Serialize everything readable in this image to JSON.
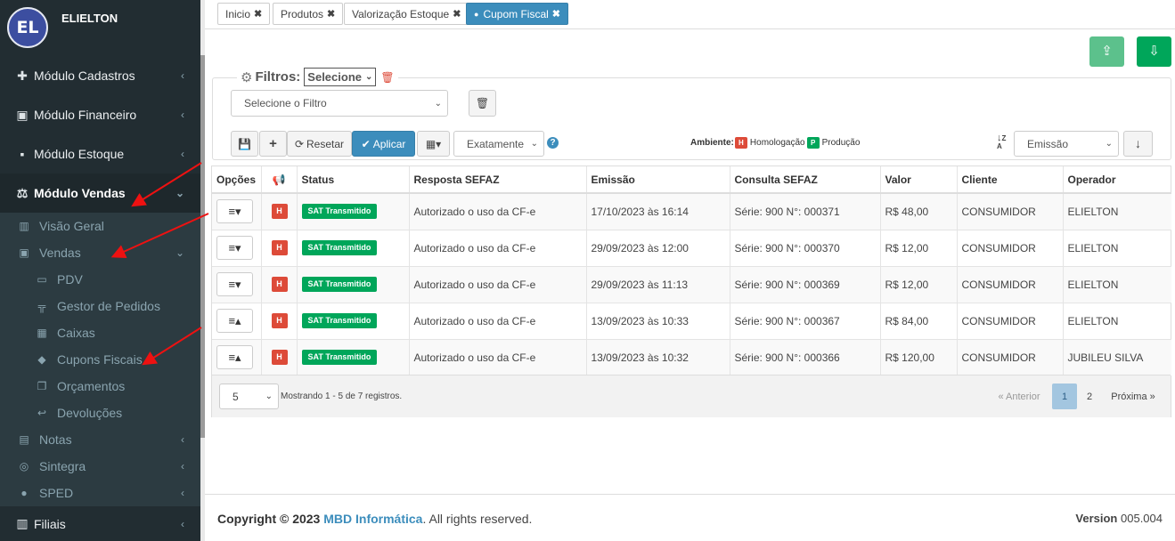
{
  "user": {
    "initials": "EL",
    "name": "ELIELTON"
  },
  "sidebar": {
    "modules": [
      {
        "label": "Módulo Cadastros",
        "icon": "plus-icon"
      },
      {
        "label": "Módulo Financeiro",
        "icon": "money-icon"
      },
      {
        "label": "Módulo Estoque",
        "icon": "box-icon"
      },
      {
        "label": "Módulo Vendas",
        "icon": "balance-scale-icon"
      }
    ],
    "vendas_sub": [
      {
        "label": "Visão Geral",
        "icon": "bar-chart-icon"
      },
      {
        "label": "Vendas",
        "icon": "money-icon"
      }
    ],
    "vendas_items": [
      {
        "label": "PDV",
        "icon": "monitor-icon"
      },
      {
        "label": "Gestor de Pedidos",
        "icon": "sitemap-icon"
      },
      {
        "label": "Caixas",
        "icon": "cash-register-icon"
      },
      {
        "label": "Cupons Fiscais",
        "icon": "tag-icon"
      },
      {
        "label": "Orçamentos",
        "icon": "copy-icon"
      },
      {
        "label": "Devoluções",
        "icon": "reply-icon"
      }
    ],
    "other_sub": [
      {
        "label": "Notas",
        "icon": "file-icon"
      },
      {
        "label": "Sintegra",
        "icon": "database-icon"
      },
      {
        "label": "SPED",
        "icon": "code-icon"
      }
    ],
    "filiais": {
      "label": "Filiais",
      "icon": "bar-chart-icon"
    }
  },
  "tabs": [
    {
      "label": "Inicio"
    },
    {
      "label": "Produtos"
    },
    {
      "label": "Valorização Estoque"
    },
    {
      "label": "Cupom Fiscal"
    }
  ],
  "filters": {
    "title": "Filtros:",
    "legend_select": "Selecione",
    "filter_select": "Selecione o Filtro",
    "reset_label": "Resetar",
    "apply_label": "Aplicar",
    "match_select": "Exatamente",
    "ambiente_label": "Ambiente:",
    "homologacao": "Homologação",
    "producao": "Produção",
    "h_letter": "H",
    "p_letter": "P",
    "sort_select": "Emissão"
  },
  "table": {
    "columns": [
      "Opções",
      "",
      "Status",
      "Resposta SEFAZ",
      "Emissão",
      "Consulta SEFAZ",
      "Valor",
      "Cliente",
      "Operador"
    ],
    "rows": [
      {
        "env": "H",
        "status": "SAT Transmitido",
        "resposta": "Autorizado o uso da CF-e",
        "emissao": "17/10/2023 às 16:14",
        "consulta": "Série: 900 N°: 000371",
        "valor": "R$ 48,00",
        "cliente": "CONSUMIDOR",
        "operador": "ELIELTON"
      },
      {
        "env": "H",
        "status": "SAT Transmitido",
        "resposta": "Autorizado o uso da CF-e",
        "emissao": "29/09/2023 às 12:00",
        "consulta": "Série: 900 N°: 000370",
        "valor": "R$ 12,00",
        "cliente": "CONSUMIDOR",
        "operador": "ELIELTON"
      },
      {
        "env": "H",
        "status": "SAT Transmitido",
        "resposta": "Autorizado o uso da CF-e",
        "emissao": "29/09/2023 às 11:13",
        "consulta": "Série: 900 N°: 000369",
        "valor": "R$ 12,00",
        "cliente": "CONSUMIDOR",
        "operador": "ELIELTON"
      },
      {
        "env": "H",
        "status": "SAT Transmitido",
        "resposta": "Autorizado o uso da CF-e",
        "emissao": "13/09/2023 às 10:33",
        "consulta": "Série: 900 N°: 000367",
        "valor": "R$ 84,00",
        "cliente": "CONSUMIDOR",
        "operador": "ELIELTON"
      },
      {
        "env": "H",
        "status": "SAT Transmitido",
        "resposta": "Autorizado o uso da CF-e",
        "emissao": "13/09/2023 às 10:32",
        "consulta": "Série: 900 N°: 000366",
        "valor": "R$ 120,00",
        "cliente": "CONSUMIDOR",
        "operador": "JUBILEU SILVA"
      }
    ],
    "page_size": "5",
    "showing": "Mostrando 1 - 5 de 7 registros.",
    "prev": "« Anterior",
    "page1": "1",
    "page2": "2",
    "next": "Próxima »"
  },
  "footer": {
    "copyright_prefix": "Copyright © 2023",
    "brand": "MBD Informática",
    "suffix": ". All rights reserved.",
    "version_label": "Version",
    "version": "005.004"
  },
  "colors": {
    "primary": "#3c8dbc",
    "success": "#00a65a",
    "danger": "#dd4b39",
    "sidebar": "#222d32"
  }
}
